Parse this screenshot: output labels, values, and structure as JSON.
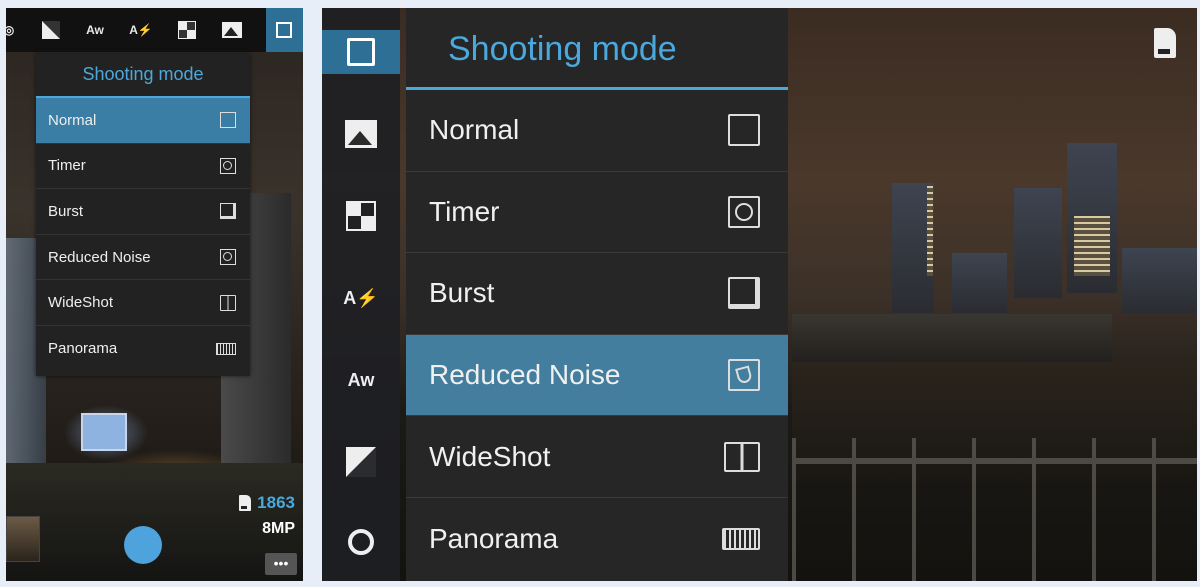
{
  "left_panel": {
    "toolbar": {
      "icons": [
        "ev-icon",
        "auto-white-balance-icon",
        "auto-flash-icon",
        "focus-mode-icon",
        "scene-icon",
        "shooting-mode-icon"
      ]
    },
    "menu": {
      "title": "Shooting mode",
      "selected": "Normal",
      "items": [
        {
          "label": "Normal",
          "icon": "normal-mode-icon"
        },
        {
          "label": "Timer",
          "icon": "timer-icon"
        },
        {
          "label": "Burst",
          "icon": "burst-icon"
        },
        {
          "label": "Reduced Noise",
          "icon": "reduced-noise-icon"
        },
        {
          "label": "WideShot",
          "icon": "wideshot-icon"
        },
        {
          "label": "Panorama",
          "icon": "panorama-icon"
        }
      ]
    },
    "status": {
      "remaining_shots": "1863",
      "resolution": "8MP"
    },
    "more_label": "•••"
  },
  "right_panel": {
    "sidebar": {
      "items": [
        {
          "name": "shooting-mode-icon",
          "label": ""
        },
        {
          "name": "scene-icon",
          "label": ""
        },
        {
          "name": "focus-mode-icon",
          "label": ""
        },
        {
          "name": "auto-flash-icon",
          "label": "A⚡"
        },
        {
          "name": "auto-white-balance-icon",
          "label": "Aw"
        },
        {
          "name": "ev-icon",
          "label": ""
        },
        {
          "name": "timer-icon",
          "label": ""
        }
      ]
    },
    "menu": {
      "title": "Shooting mode",
      "selected": "Reduced Noise",
      "items": [
        {
          "label": "Normal",
          "icon": "normal-mode-icon"
        },
        {
          "label": "Timer",
          "icon": "timer-icon"
        },
        {
          "label": "Burst",
          "icon": "burst-icon"
        },
        {
          "label": "Reduced Noise",
          "icon": "reduced-noise-icon"
        },
        {
          "label": "WideShot",
          "icon": "wideshot-icon"
        },
        {
          "label": "Panorama",
          "icon": "panorama-icon"
        }
      ]
    }
  },
  "colors": {
    "accent": "#4aa8dc",
    "selected_row": "#3a7ea6",
    "menu_bg": "#262626"
  }
}
